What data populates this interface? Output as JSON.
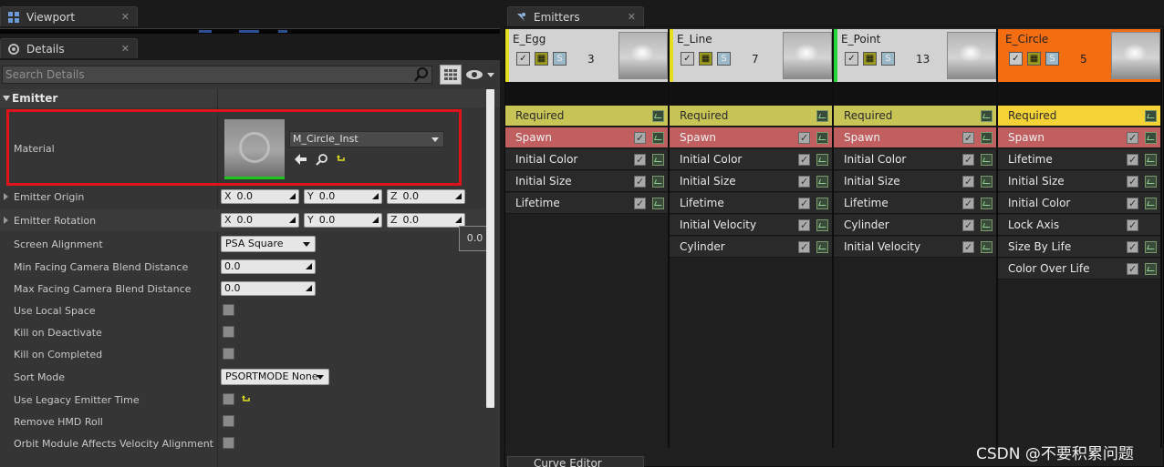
{
  "left_panel": {
    "viewport_tab": {
      "label": "Viewport",
      "close": "✕"
    },
    "details_tab": {
      "label": "Details",
      "close": "✕"
    },
    "search": {
      "placeholder": "Search Details"
    },
    "category": "Emitter",
    "material": {
      "label": "Material",
      "value": "M_Circle_Inst"
    },
    "emitter_origin": {
      "label": "Emitter Origin",
      "x": "0.0",
      "y": "0.0",
      "z": "0.0"
    },
    "emitter_rotation": {
      "label": "Emitter Rotation",
      "x": "0.0",
      "y": "0.0",
      "z": "0.0",
      "tooltip": "0.0"
    },
    "screen_alignment": {
      "label": "Screen Alignment",
      "value": "PSA Square"
    },
    "min_facing": {
      "label": "Min Facing Camera Blend Distance",
      "value": "0.0"
    },
    "max_facing": {
      "label": "Max Facing Camera Blend Distance",
      "value": "0.0"
    },
    "use_local_space": {
      "label": "Use Local Space"
    },
    "kill_on_deactivate": {
      "label": "Kill on Deactivate"
    },
    "kill_on_completed": {
      "label": "Kill on Completed"
    },
    "sort_mode": {
      "label": "Sort Mode",
      "value": "PSORTMODE None"
    },
    "use_legacy_time": {
      "label": "Use Legacy Emitter Time"
    },
    "remove_hmd_roll": {
      "label": "Remove HMD Roll"
    },
    "orbit_module": {
      "label": "Orbit Module Affects Velocity Alignment"
    },
    "axis": {
      "x": "X",
      "y": "Y",
      "z": "Z"
    }
  },
  "emitters_panel": {
    "tab": {
      "label": "Emitters",
      "close": "✕"
    },
    "curve_tab": "Curve Editor",
    "columns": [
      {
        "name": "E_Egg",
        "count": "3",
        "bar_color": "#e5df1f",
        "modules": [
          "Required",
          "Spawn",
          "Initial Color",
          "Initial Size",
          "Lifetime"
        ]
      },
      {
        "name": "E_Line",
        "count": "7",
        "bar_color": "#e5df1f",
        "modules": [
          "Required",
          "Spawn",
          "Initial Color",
          "Initial Size",
          "Lifetime",
          "Initial Velocity",
          "Cylinder"
        ]
      },
      {
        "name": "E_Point",
        "count": "13",
        "bar_color": "#24d63a",
        "modules": [
          "Required",
          "Spawn",
          "Initial Color",
          "Initial Size",
          "Lifetime",
          "Cylinder",
          "Initial Velocity"
        ]
      },
      {
        "name": "E_Circle",
        "count": "5",
        "bar_color": "#f46d10",
        "modules": [
          "Required",
          "Spawn",
          "Lifetime",
          "Initial Size",
          "Initial Color",
          "Lock Axis",
          "Size By Life",
          "Color Over Life"
        ]
      }
    ]
  },
  "watermark": "CSDN @不要积累问题",
  "colors": {
    "selection_red": "#e0131b",
    "selected_emitter": "#f46d10",
    "required_module": "#c8c556",
    "spawn_module": "#c15f60"
  }
}
